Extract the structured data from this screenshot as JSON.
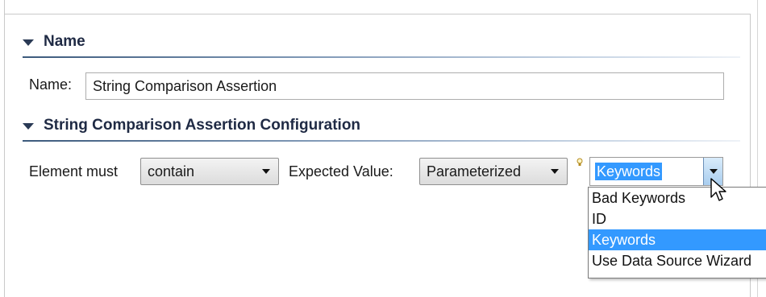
{
  "name_section": {
    "title": "Name",
    "name_label": "Name:",
    "name_value": "String Comparison Assertion"
  },
  "config_section": {
    "title": "String Comparison Assertion Configuration",
    "element_must_label": "Element must",
    "element_must_value": "contain",
    "expected_value_label": "Expected Value:",
    "expected_value_mode": "Parameterized",
    "parameter_value": "Keywords",
    "parameter_options": [
      {
        "label": "Bad Keywords",
        "selected": false
      },
      {
        "label": "ID",
        "selected": false
      },
      {
        "label": "Keywords",
        "selected": true
      },
      {
        "label": "Use Data Source Wizard",
        "selected": false
      }
    ]
  },
  "icons": {
    "section_toggle": "triangle-down-icon",
    "combo_arrow": "chevron-down-icon",
    "hint": "lightbulb-icon",
    "pointer": "mouse-pointer-icon"
  },
  "colors": {
    "selection": "#3399ff",
    "section_text": "#1f2a44",
    "section_line": "#3c5a7c"
  }
}
